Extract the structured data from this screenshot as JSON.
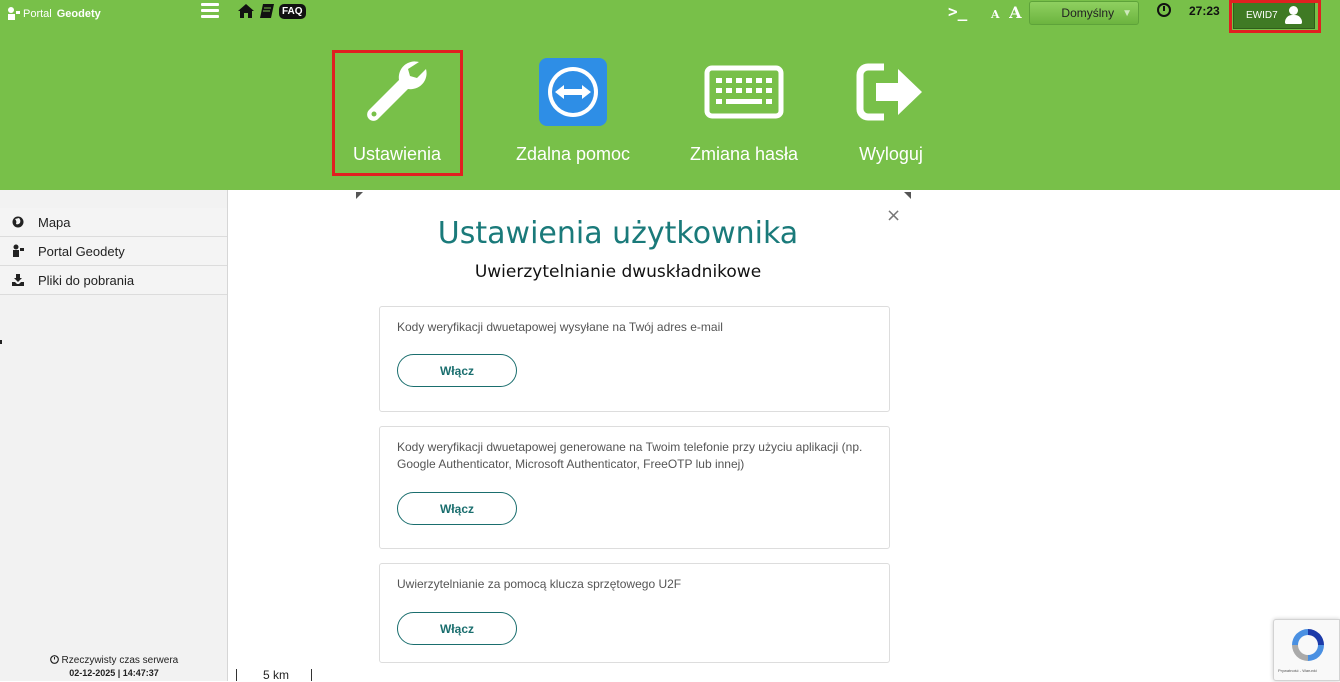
{
  "header": {
    "logo_text": "Portal",
    "logo_bold": "Geodety",
    "faq_label": "FAQ",
    "font_small": "A",
    "font_big": "A",
    "theme_value": "Domyślny",
    "session_time": "27:23",
    "user_label": "EWID7"
  },
  "main_menu": [
    {
      "label": "Ustawienia",
      "icon": "wrench-icon"
    },
    {
      "label": "Zdalna pomoc",
      "icon": "teamviewer-icon"
    },
    {
      "label": "Zmiana hasła",
      "icon": "keyboard-icon"
    },
    {
      "label": "Wyloguj",
      "icon": "logout-icon"
    }
  ],
  "sidebar": {
    "items": [
      {
        "label": "Mapa",
        "icon": "globe-icon"
      },
      {
        "label": "Portal Geodety",
        "icon": "surveyor-icon"
      },
      {
        "label": "Pliki do pobrania",
        "icon": "download-icon"
      }
    ],
    "server_time_label": "Rzeczywisty czas serwera",
    "server_date": "02-12-2025",
    "server_clock": "14:47:37"
  },
  "map": {
    "scale_label": "5 km"
  },
  "modal": {
    "title": "Ustawienia użytkownika",
    "subtitle": "Uwierzytelnianie dwuskładnikowe",
    "close_label": "×",
    "cards": [
      {
        "text": "Kody weryfikacji dwuetapowej wysyłane na Twój adres e-mail",
        "button_label": "Włącz"
      },
      {
        "text": "Kody weryfikacji dwuetapowej generowane na Twoim telefonie przy użyciu aplikacji (np. Google Authenticator, Microsoft Authenticator, FreeOTP lub innej)",
        "button_label": "Włącz"
      },
      {
        "text": "Uwierzytelnianie za pomocą klucza sprzętowego U2F",
        "button_label": "Włącz"
      }
    ]
  },
  "recaptcha": {
    "footer_text": "Prywatność - Warunki"
  },
  "colors": {
    "header_green": "#78c049",
    "highlight_red": "#e02020",
    "modal_teal": "#1a7a7a"
  }
}
